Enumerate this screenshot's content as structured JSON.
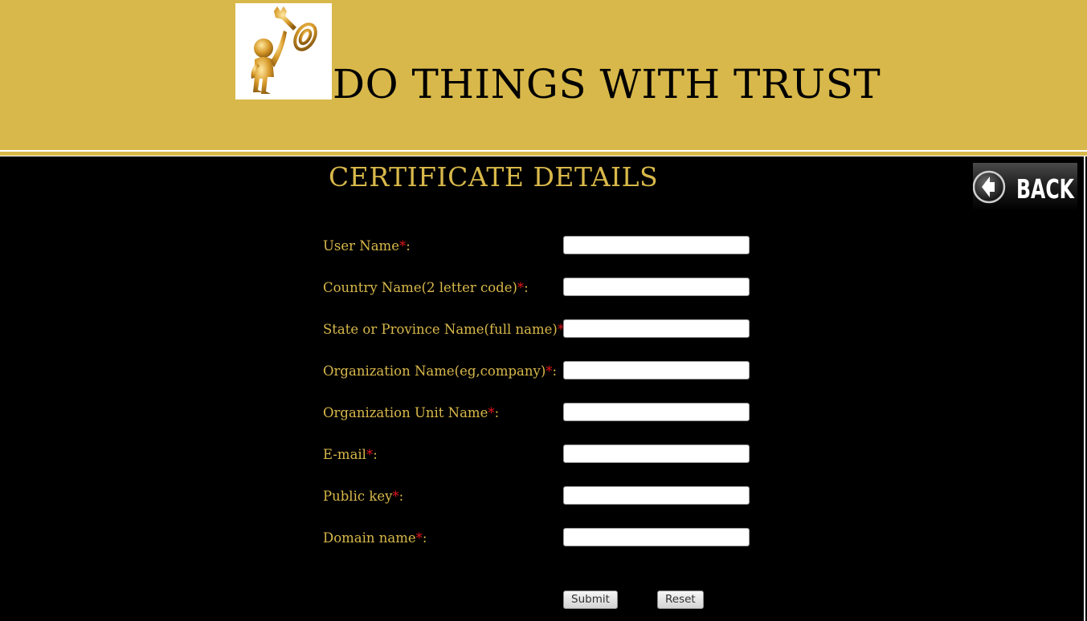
{
  "header": {
    "logo_icon": "golden-figure-holding-key-icon",
    "slogan": "DO THINGS WITH TRUST"
  },
  "main": {
    "title": "CERTIFICATE DETAILS",
    "back_button_label": "BACK",
    "required_marker": "*",
    "label_suffix": ":",
    "fields": [
      {
        "label": "User Name",
        "value": ""
      },
      {
        "label": "Country Name(2 letter code)",
        "value": ""
      },
      {
        "label": "State or Province Name(full name)",
        "value": ""
      },
      {
        "label": "Organization Name(eg,company)",
        "value": ""
      },
      {
        "label": "Organization Unit Name",
        "value": ""
      },
      {
        "label": "E-mail",
        "value": ""
      },
      {
        "label": "Public key",
        "value": ""
      },
      {
        "label": "Domain name",
        "value": ""
      }
    ],
    "submit_label": "Submit",
    "reset_label": "Reset"
  },
  "colors": {
    "header_bg": "#d8b84a",
    "page_bg": "#000000",
    "label_text": "#d8b84a",
    "required_marker": "#e0161c"
  }
}
